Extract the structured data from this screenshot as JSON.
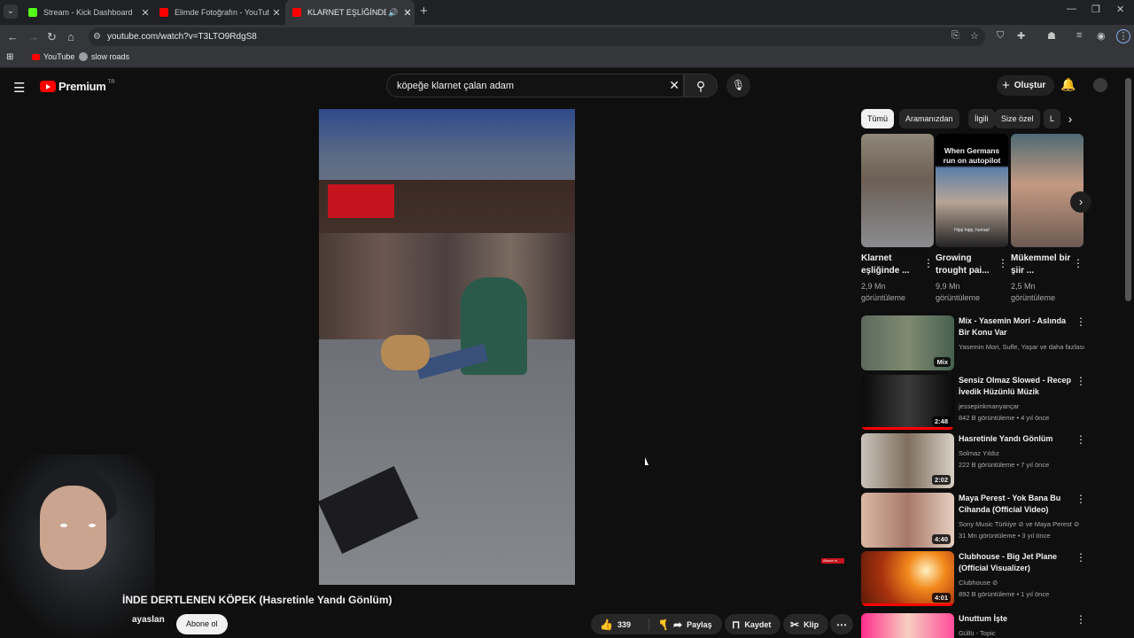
{
  "browser": {
    "tabs": [
      {
        "title": "Stream - Kick Dashboard",
        "favicon_color": "#53fc18"
      },
      {
        "title": "Elimde Fotoğrafın - YouTube",
        "favicon_color": "#ff0000"
      },
      {
        "title": "KLARNET EŞLİĞİNDE DERT",
        "favicon_color": "#ff0000"
      }
    ],
    "new_tab": "+",
    "url": "youtube.com/watch?v=T3LTO9RdgS8",
    "bookmarks": [
      {
        "label": "YouTube"
      },
      {
        "label": "slow roads"
      }
    ]
  },
  "header": {
    "logo_text": "Premium",
    "country_code": "TR",
    "search_query": "köpeğe klarnet çalan adam",
    "create_label": "Oluştur"
  },
  "video": {
    "title": "İNDE DERTLENEN KÖPEK (Hasretinle Yandı Gönlüm)",
    "channel": "ayaslan",
    "subscribe_label": "Abone ol",
    "likes": "339",
    "share_label": "Paylaş",
    "save_label": "Kaydet",
    "clip_label": "Klip",
    "mini_badge": "Abone ol"
  },
  "chips": [
    "Tümü",
    "Aramanızdan",
    "İlgili",
    "Size özel",
    "L"
  ],
  "shorts": [
    {
      "title": "Klarnet eşliğinde ...",
      "views": "2,9 Mn",
      "views_suffix": "görüntüleme"
    },
    {
      "title": "Growing trought pai...",
      "views": "9,9 Mn",
      "views_suffix": "görüntüleme",
      "overlay": "When Germans run on autopilot",
      "caption": "Hipp hipp, hurraa!"
    },
    {
      "title": "Mükemmel bir şiir ...",
      "views": "2,5 Mn",
      "views_suffix": "görüntüleme"
    }
  ],
  "recommendations": [
    {
      "title": "Mix - Yasemin Mori - Aslında Bir Konu Var",
      "channel": "Yasemin Mori, Sufle, Yaşar ve daha fazlası",
      "meta": "",
      "duration": "Mix"
    },
    {
      "title": "Sensiz Olmaz Slowed - Recep İvedik Hüzünlü Müzik",
      "channel": "jessepinkmanyançar",
      "meta": "842 B görüntüleme • 4 yıl önce",
      "duration": "2:48"
    },
    {
      "title": "Hasretinle Yandı Gönlüm",
      "channel": "Solmaz Yıldız",
      "meta": "222 B görüntüleme • 7 yıl önce",
      "duration": "2:02"
    },
    {
      "title": "Maya Perest - Yok Bana Bu Cihanda (Official Video)",
      "channel": "Sony Music Türkiye ⊘ ve Maya Perest ⊘",
      "meta": "31 Mn görüntüleme • 3 yıl önce",
      "duration": "4:40"
    },
    {
      "title": "Clubhouse - Big Jet Plane (Official Visualizer)",
      "channel": "Clubhouse ⊘",
      "meta": "892 B görüntüleme • 1 yıl önce",
      "duration": "4:01"
    },
    {
      "title": "Unuttum İşte",
      "channel": "Güllü - Topic",
      "meta": "",
      "duration": ""
    }
  ]
}
